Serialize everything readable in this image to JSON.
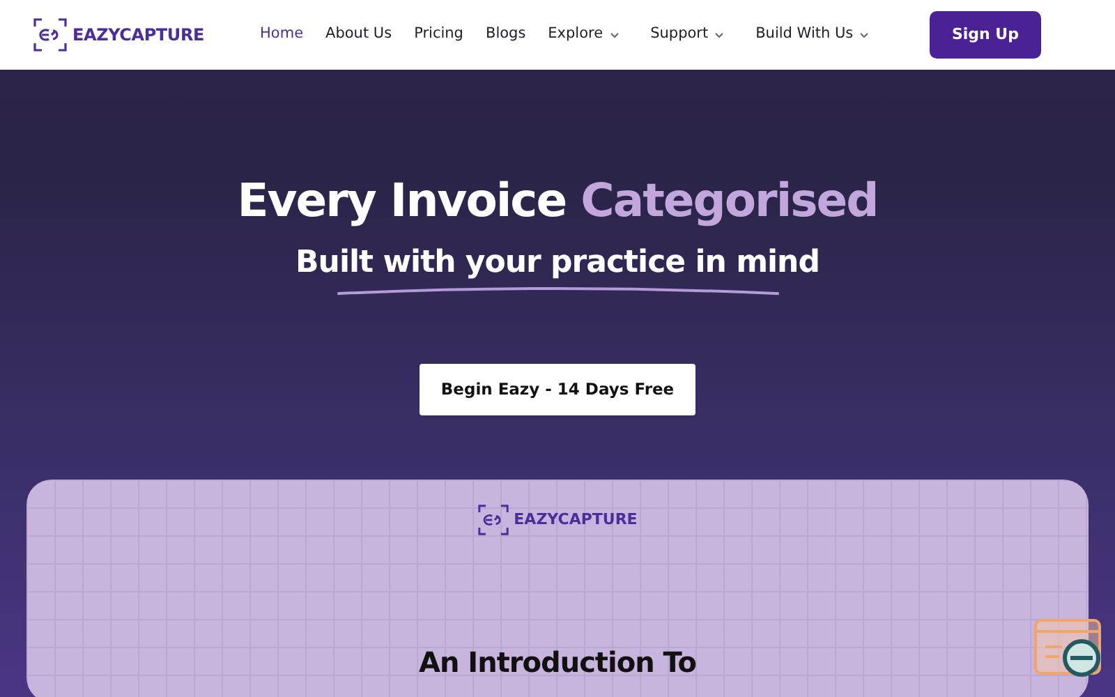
{
  "navbar": {
    "brand": "EAZYCAPTURE",
    "items": [
      {
        "label": "Home",
        "selected": true,
        "dropdown": false
      },
      {
        "label": "About Us",
        "selected": false,
        "dropdown": false
      },
      {
        "label": "Pricing",
        "selected": false,
        "dropdown": false
      },
      {
        "label": "Blogs",
        "selected": false,
        "dropdown": false
      },
      {
        "label": "Explore",
        "selected": false,
        "dropdown": true
      },
      {
        "label": "Support",
        "selected": false,
        "dropdown": true
      },
      {
        "label": "Build With Us",
        "selected": false,
        "dropdown": true
      }
    ],
    "button": "Sign Up"
  },
  "hero": {
    "title": "Every Invoice",
    "title_highlight": "Categorised",
    "subtitle": "Built with your practice in mind",
    "cta": "Begin Eazy - 14 Days Free"
  },
  "panel": {
    "brand": "EAZYCAPTURE",
    "heading": "An Introduction To"
  }
}
